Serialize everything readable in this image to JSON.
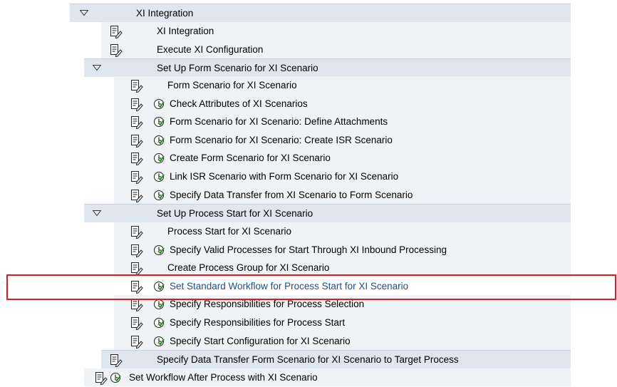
{
  "tree": {
    "root": {
      "label": "XI Integration",
      "expanded": true
    },
    "items": [
      {
        "id": "xi-integration",
        "label": "XI Integration",
        "doc_icon": "document-pencil-icon",
        "clock_icon": null
      },
      {
        "id": "execute-xi-configuration",
        "label": "Execute XI Configuration",
        "doc_icon": "document-pencil-icon",
        "clock_icon": null
      }
    ],
    "form_scenario_group": {
      "label": "Set Up Form Scenario for XI Scenario",
      "expanded": true,
      "items": [
        {
          "label": "Form Scenario for XI Scenario",
          "has_execute": false
        },
        {
          "label": "Check Attributes of XI Scenarios",
          "has_execute": true
        },
        {
          "label": "Form Scenario for XI Scenario: Define Attachments",
          "has_execute": true
        },
        {
          "label": "Form Scenario for XI Scenario: Create ISR Scenario",
          "has_execute": true
        },
        {
          "label": "Create Form Scenario for XI Scenario",
          "has_execute": true
        },
        {
          "label": "Link ISR Scenario with Form Scenario for XI Scenario",
          "has_execute": true
        },
        {
          "label": "Specify Data Transfer from XI Scenario to Form Scenario",
          "has_execute": true
        }
      ]
    },
    "process_start_group": {
      "label": "Set Up Process Start for XI Scenario",
      "expanded": true,
      "items": [
        {
          "label": "Process Start for XI Scenario",
          "has_execute": false
        },
        {
          "label": "Specify Valid Processes for Start Through XI Inbound Processing",
          "has_execute": true
        },
        {
          "label": "Create Process Group for XI Scenario",
          "has_execute": false
        },
        {
          "label": "Set Standard Workflow for Process Start for XI Scenario",
          "has_execute": true,
          "highlighted": true
        },
        {
          "label": "Specify Responsibilities for Process Selection",
          "has_execute": true
        },
        {
          "label": "Specify Responsibilities for Process Start",
          "has_execute": true
        },
        {
          "label": "Specify Start Configuration for XI Scenario",
          "has_execute": true
        }
      ]
    },
    "tail_items": [
      {
        "label": "Specify Data Transfer Form Scenario for XI Scenario to Target Process",
        "has_execute": false
      },
      {
        "label": "Set Workflow After Process with XI Scenario",
        "has_execute": true
      }
    ]
  },
  "icons": {
    "document": "document-pencil-icon",
    "execute": "execute-clock-icon",
    "expand": "triangle-down-icon"
  },
  "colors": {
    "group_row": "#dfe6ed",
    "sub_row": "#eff3f6",
    "link_text": "#1b4f8a",
    "highlight_border": "#e8181a",
    "clock_green": "#2e8b2e"
  }
}
